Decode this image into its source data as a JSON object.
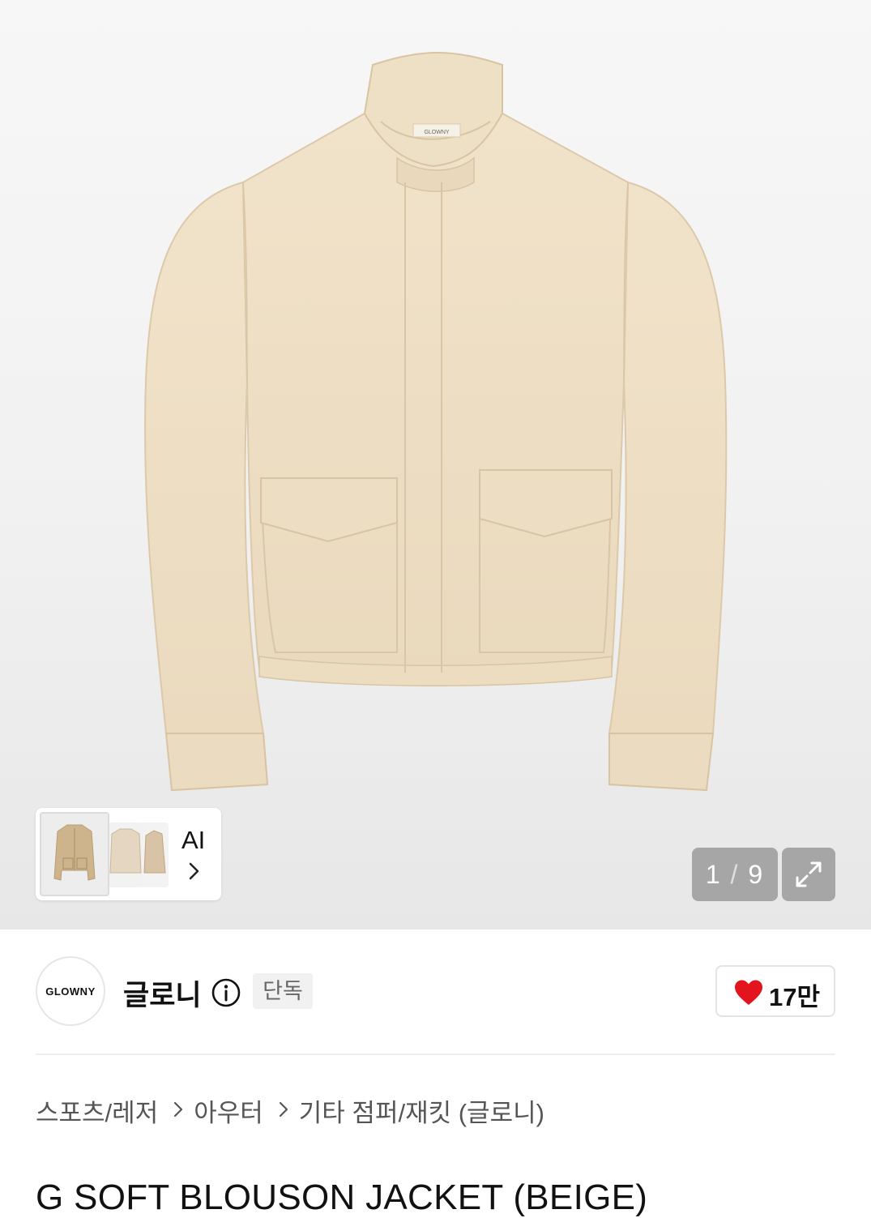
{
  "gallery": {
    "current": "1",
    "total": "9",
    "separator": "/",
    "ai_label": "AI",
    "thumbnails": [
      "jacket-front",
      "jacket-alt",
      "jacket-side"
    ]
  },
  "brand": {
    "logo_text": "GLOWNY",
    "name": "글로니",
    "badge": "단독"
  },
  "likes": {
    "count": "17만"
  },
  "breadcrumb": [
    "스포츠/레저",
    "아우터",
    "기타 점퍼/재킷 (글로니)"
  ],
  "product": {
    "title": "G SOFT BLOUSON JACKET (BEIGE)"
  },
  "colors": {
    "jacket": "#efe0c6",
    "heart": "#e3141d"
  }
}
